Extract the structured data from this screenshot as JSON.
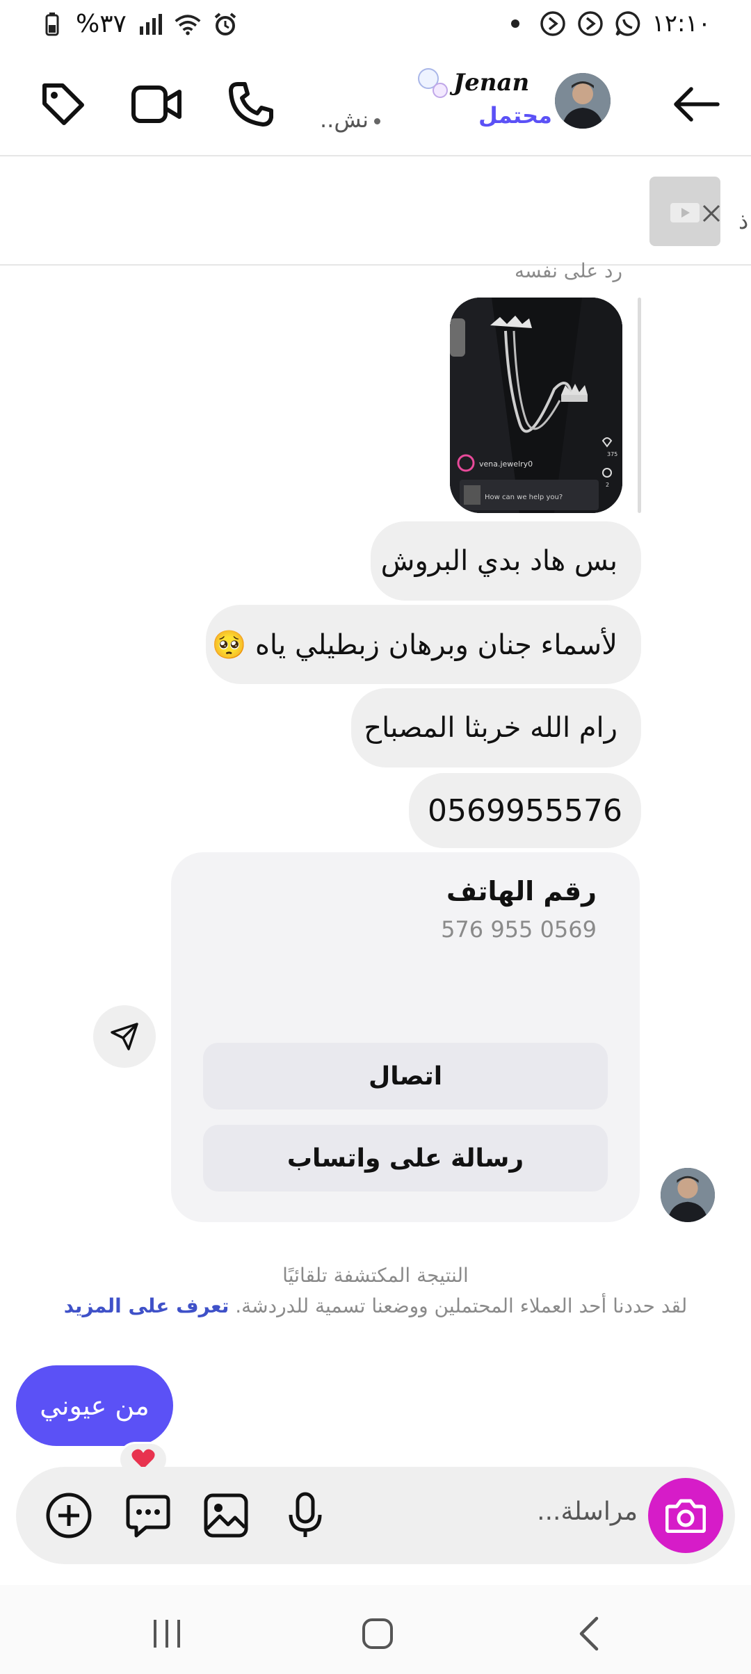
{
  "status_bar": {
    "time": "١٢:١٠",
    "battery": "%٣٧",
    "icons": [
      "whatsapp-icon",
      "sync-icon",
      "sync-icon",
      "dot-icon",
      "alarm-icon",
      "wifi-icon",
      "signal-icon",
      "battery-icon"
    ]
  },
  "header": {
    "contact_name": "Jenan",
    "label": "محتمل",
    "status": "نش..",
    "icons": [
      "back-arrow-icon",
      "phone-icon",
      "video-call-icon",
      "tag-icon"
    ]
  },
  "reply_preview": {
    "text": "ذ"
  },
  "conversation": {
    "replied_to_self": "رد على نفسه",
    "shared_post": {
      "account": "vena.jewelry0",
      "prompt": "How can we help you?",
      "likes": "375",
      "comments": "2"
    },
    "messages": [
      "بس هاد بدي البروش",
      "لأسماء جنان وبرهان زبطيلي ياه 🥺",
      "رام الله خربثا المصباح",
      "0569955576"
    ],
    "phone_card": {
      "title": "رقم الهاتف",
      "number": "576 955 0569",
      "call_button": "اتصال",
      "whatsapp_button": "رسالة على واتساب"
    },
    "auto_detect": {
      "title": "النتيجة المكتشفة تلقائيًا",
      "body": "لقد حددنا أحد العملاء المحتملين ووضعنا تسمية للدردشة.",
      "link": "تعرف على المزيد"
    },
    "sent_message": "من عيوني",
    "reaction": "❤️"
  },
  "composer": {
    "placeholder": "مراسلة..."
  },
  "colors": {
    "accent_purple": "#5b51f6",
    "camera_magenta": "#d61cc8",
    "link_blue": "#3f51c8"
  }
}
